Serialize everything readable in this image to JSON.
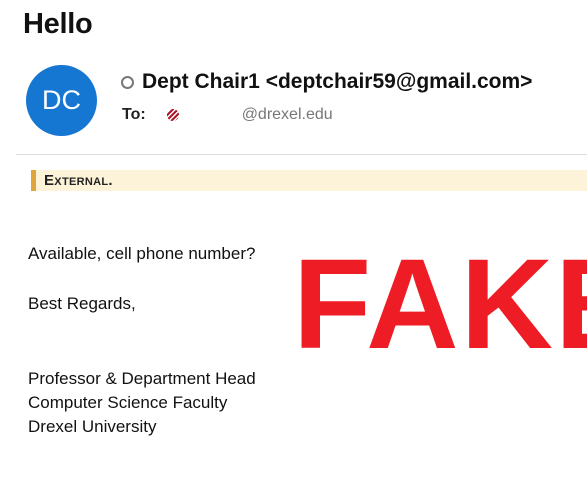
{
  "email": {
    "subject": "Hello",
    "sender": {
      "initials": "DC",
      "avatar_color": "#1677d2",
      "display": "Dept Chair1 <deptchair59@gmail.com>"
    },
    "to": {
      "label": "To:",
      "address": "@drexel.edu"
    },
    "banner": {
      "label": "External.",
      "accent_color": "#e0a43a",
      "background_color": "#fdf3d8"
    },
    "body": {
      "line1": "Available, cell phone number?",
      "line2": "Best Regards,",
      "signature": [
        "Professor & Department Head",
        "Computer Science Faculty",
        "Drexel University"
      ]
    }
  },
  "overlay": {
    "stamp_text": "FAKE",
    "stamp_color": "#ee1c24"
  }
}
